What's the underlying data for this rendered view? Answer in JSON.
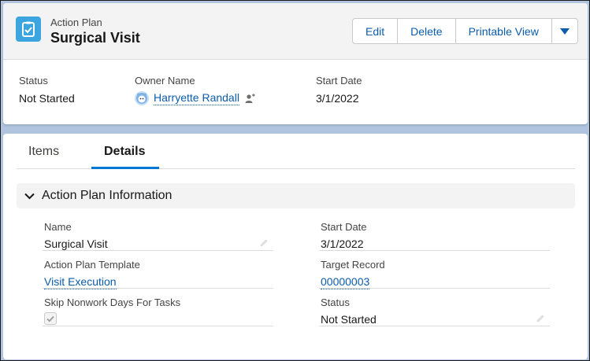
{
  "header": {
    "object_label": "Action Plan",
    "record_title": "Surgical Visit",
    "buttons": {
      "edit": "Edit",
      "delete": "Delete",
      "printable_view": "Printable View"
    }
  },
  "highlights": {
    "status_label": "Status",
    "status_value": "Not Started",
    "owner_label": "Owner Name",
    "owner_value": "Harryette Randall",
    "start_date_label": "Start Date",
    "start_date_value": "3/1/2022"
  },
  "tabs": [
    "Items",
    "Details"
  ],
  "section": {
    "title": "Action Plan Information"
  },
  "fields": {
    "name_label": "Name",
    "name_value": "Surgical Visit",
    "start_date_label": "Start Date",
    "start_date_value": "3/1/2022",
    "template_label": "Action Plan Template",
    "template_value": "Visit Execution",
    "target_record_label": "Target Record",
    "target_record_value": "00000003",
    "skip_nonwork_label": "Skip Nonwork Days For Tasks",
    "skip_nonwork_value": true,
    "status_label": "Status",
    "status_value": "Not Started"
  },
  "colors": {
    "background": "#b0c4df",
    "brand_link": "#0b5cab",
    "active_tab": "#0176d3",
    "record_icon": "#3ba5e0"
  },
  "icons": {
    "record": "action-plan-icon",
    "owner_avatar": "avatar-icon",
    "owner_change": "change-owner-icon",
    "menu": "chevron-down-icon",
    "section_toggle": "chevron-down-icon",
    "edit_field": "pencil-icon",
    "checkbox": "check-icon"
  }
}
